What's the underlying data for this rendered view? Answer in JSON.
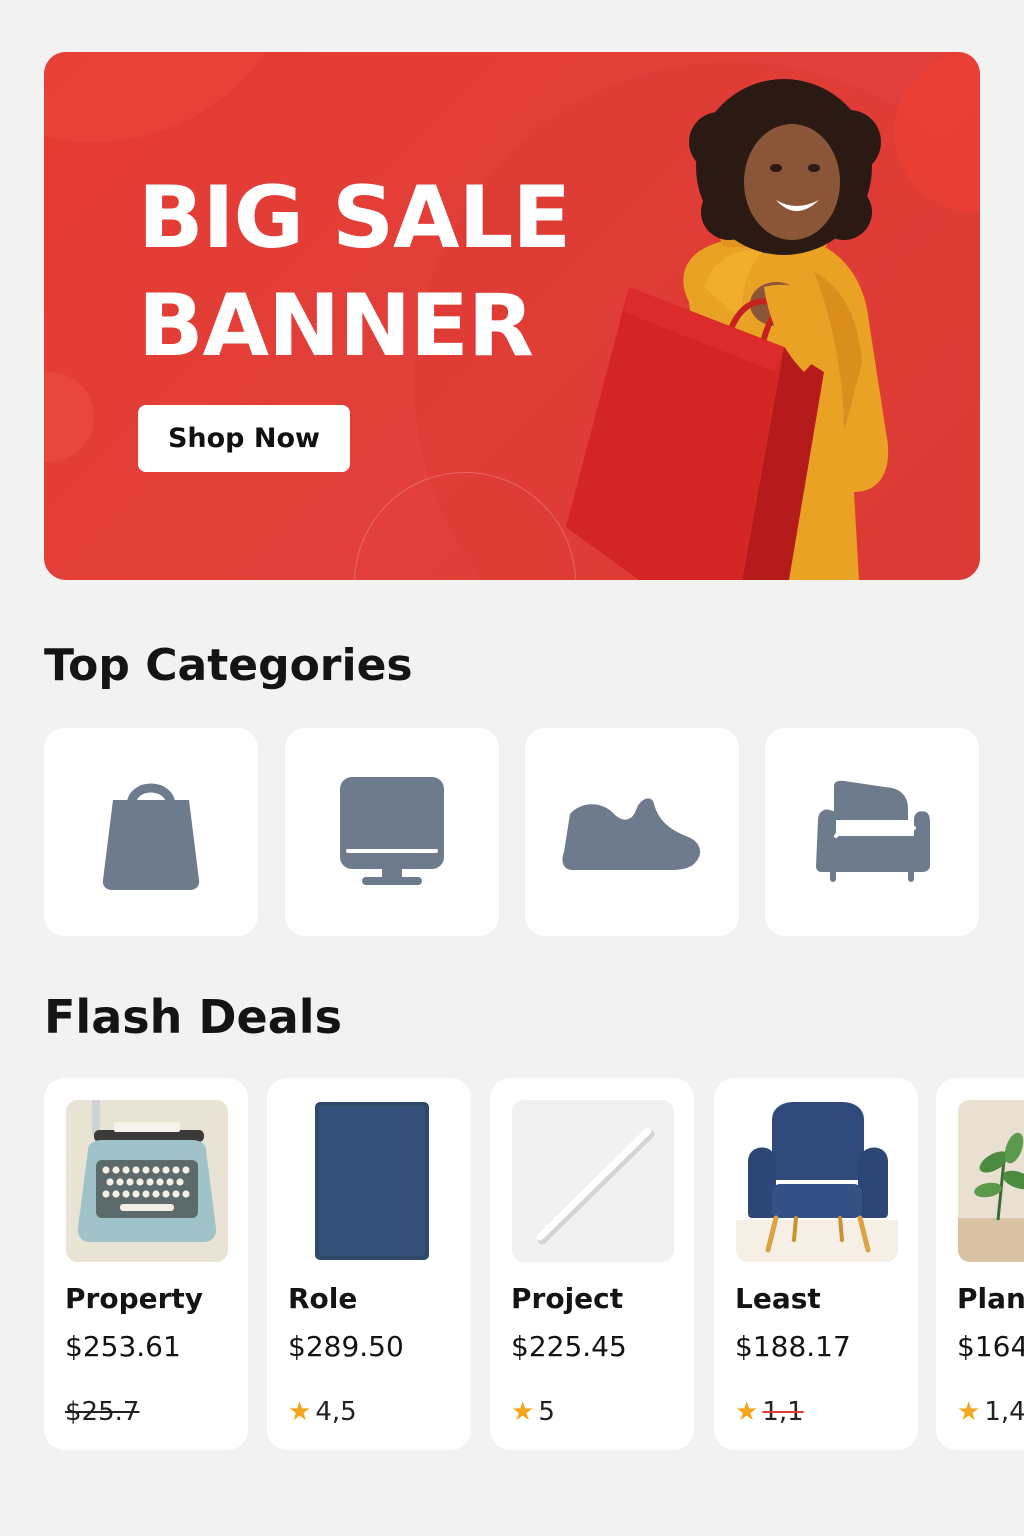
{
  "banner": {
    "title": "BIG SALE\nBANNER",
    "cta_label": "Shop Now",
    "background_color": "#e2403a"
  },
  "categories": {
    "title": "Top Categories",
    "items": [
      {
        "icon": "shopping-bag-icon"
      },
      {
        "icon": "monitor-icon"
      },
      {
        "icon": "sneaker-icon"
      },
      {
        "icon": "sofa-icon"
      }
    ],
    "icon_color": "#6e7b8d"
  },
  "flash_deals": {
    "title": "Flash Deals",
    "items": [
      {
        "name": "Property",
        "price": "$253.61",
        "old_price": "$25.7"
      },
      {
        "name": "Role",
        "price": "$289.50",
        "rating": "4,5"
      },
      {
        "name": "Project",
        "price": "$225.45",
        "rating": "5"
      },
      {
        "name": "Least",
        "price": "$188.17",
        "rating": "1,1"
      },
      {
        "name": "Plant",
        "price": "$164",
        "rating": "1,4"
      }
    ],
    "star_color": "#f4a51c"
  }
}
